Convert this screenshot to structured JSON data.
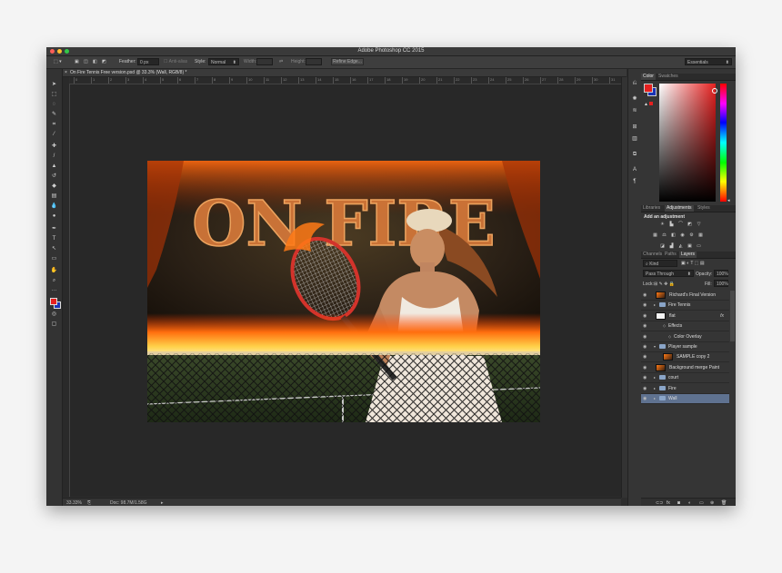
{
  "app": {
    "title": "Adobe Photoshop CC 2015",
    "workspace": "Essentials"
  },
  "options": {
    "feather_label": "Feather:",
    "feather_value": "0 px",
    "antialias_label": "Anti-alias",
    "style_label": "Style:",
    "style_value": "Normal",
    "width_label": "Width:",
    "height_label": "Height:",
    "refine_edge": "Refine Edge..."
  },
  "document": {
    "tab_label": "On Fire Tennis Free version.psd @ 33.3% (Wall, RGB/8) *",
    "ruler_ticks": [
      "0",
      "1",
      "2",
      "3",
      "4",
      "5",
      "6",
      "7",
      "8",
      "9",
      "10",
      "11",
      "12",
      "13",
      "14",
      "15",
      "16",
      "17",
      "18",
      "19",
      "20",
      "21",
      "22",
      "23",
      "24",
      "25",
      "26",
      "27",
      "28",
      "29",
      "30",
      "31",
      "32"
    ],
    "artwork_text": "ON FIRE"
  },
  "status": {
    "zoom": "33.33%",
    "doc_info": "Doc: 98.7M/1.58G"
  },
  "color_panel": {
    "tabs": [
      "Color",
      "Swatches"
    ],
    "foreground": "#e5201f",
    "background": "#1a33b5"
  },
  "adjustments_panel": {
    "tabs": [
      "Libraries",
      "Adjustments",
      "Styles"
    ],
    "heading": "Add an adjustment"
  },
  "layers_panel": {
    "tabs": [
      "Channels",
      "Paths",
      "Layers"
    ],
    "kind_label": "Kind",
    "blend_mode": "Pass Through",
    "opacity_label": "Opacity:",
    "opacity_value": "100%",
    "lock_label": "Lock:",
    "fill_label": "Fill:",
    "fill_value": "100%",
    "layers": [
      {
        "name": "Richard's Final Version",
        "type": "image",
        "indent": 0
      },
      {
        "name": "Fire Tennis",
        "type": "folder",
        "indent": 0
      },
      {
        "name": "flat",
        "type": "white",
        "indent": 0,
        "fx": "fx"
      },
      {
        "name": "Effects",
        "type": "effect",
        "indent": 1
      },
      {
        "name": "Color Overlay",
        "type": "effect",
        "indent": 2
      },
      {
        "name": "Player sample",
        "type": "folder-open",
        "indent": 0
      },
      {
        "name": "SAMPLE copy 2",
        "type": "image",
        "indent": 1
      },
      {
        "name": "Background merge Paint",
        "type": "image",
        "indent": 0
      },
      {
        "name": "court",
        "type": "folder",
        "indent": 0
      },
      {
        "name": "Fire",
        "type": "folder",
        "indent": 0
      },
      {
        "name": "Wall",
        "type": "folder",
        "indent": 0,
        "selected": true
      }
    ]
  }
}
